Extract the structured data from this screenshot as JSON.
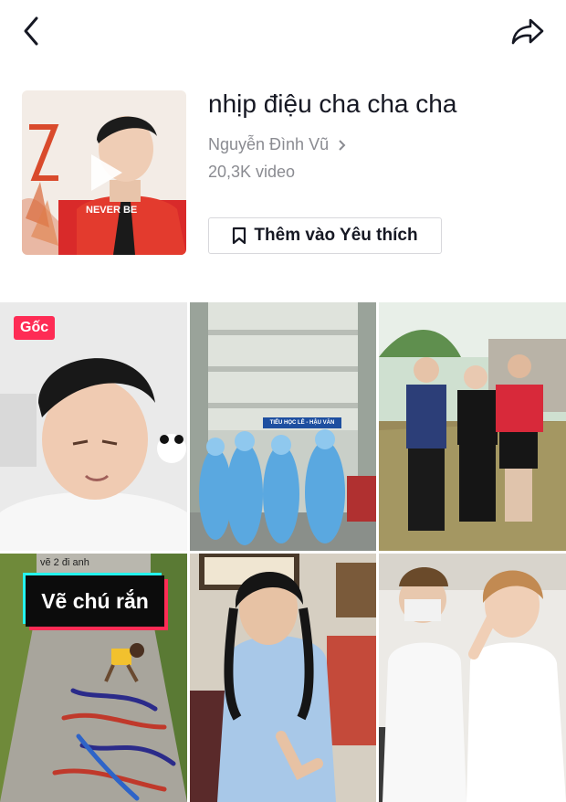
{
  "header": {
    "back_icon": "chevron-left-icon",
    "share_icon": "share-arrow-icon"
  },
  "sound": {
    "title": "nhịp điệu cha cha cha",
    "artist": "Nguyễn Đình Vũ",
    "video_count": "20,3K video",
    "cover_icon": "play-icon"
  },
  "favorite_button": {
    "label": "Thêm vào Yêu thích",
    "icon": "bookmark-icon"
  },
  "videos": [
    {
      "badge": "Gốc"
    },
    {
      "sign": "TIỂU HỌC LÊ - HẬU VĂN"
    },
    {},
    {
      "caption": "vẽ 2 đi anh",
      "label": "Vẽ chú rắn"
    },
    {},
    {}
  ],
  "colors": {
    "accent": "#fe2c55",
    "cyan": "#25f4ee",
    "text_primary": "#161823",
    "text_secondary": "#8a8b91",
    "border": "#d8d8dc"
  }
}
